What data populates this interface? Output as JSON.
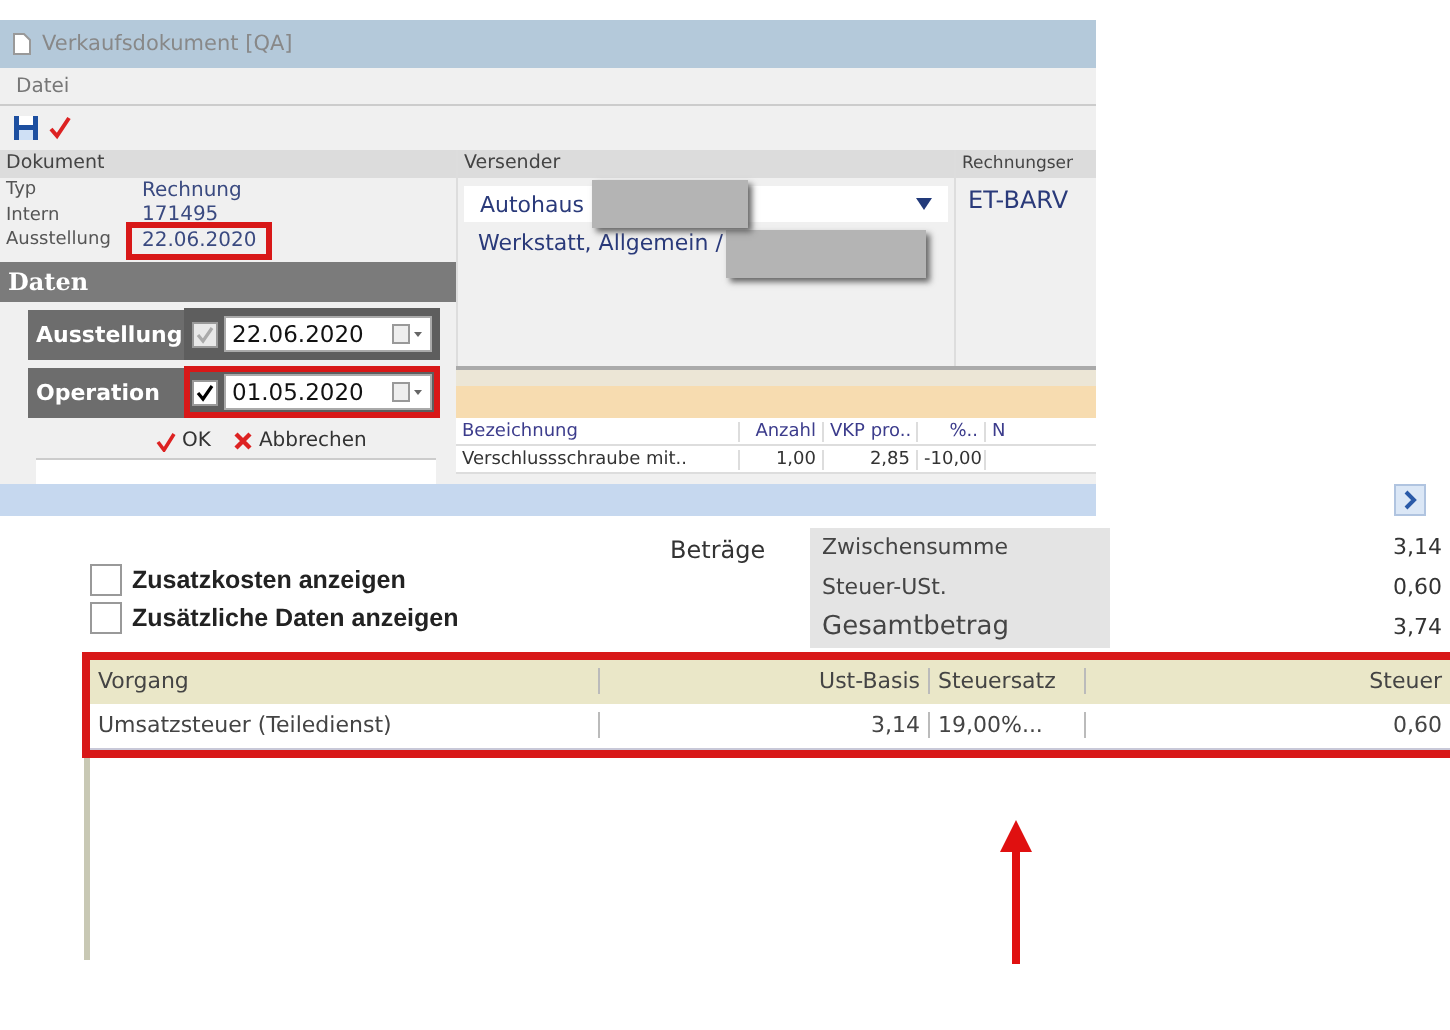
{
  "window": {
    "title": "Verkaufsdokument [QA]"
  },
  "menu": [
    "Datei"
  ],
  "dokument": {
    "header": "Dokument",
    "rows": [
      {
        "label": "Typ",
        "value": "Rechnung",
        "highlighted": false
      },
      {
        "label": "Intern",
        "value": "171495",
        "highlighted": false
      },
      {
        "label": "Ausstellung",
        "value": "22.06.2020",
        "highlighted": true
      }
    ]
  },
  "versender": {
    "header": "Versender",
    "company": "Autohaus",
    "contact": "Werkstatt,  Allgemein /"
  },
  "rechnungsempfaenger": {
    "header": "Rechnungser",
    "value": "ET-BARV"
  },
  "daten_popup": {
    "title": "Daten",
    "rows": [
      {
        "label": "Ausstellung",
        "checked": true,
        "disabled": true,
        "date": "22.06.2020",
        "highlighted": false
      },
      {
        "label": "Operation",
        "checked": true,
        "disabled": false,
        "date": "01.05.2020",
        "highlighted": true
      }
    ],
    "buttons": [
      {
        "kind": "ok",
        "label": "OK"
      },
      {
        "kind": "cancel",
        "label": "Abbrechen"
      }
    ]
  },
  "items_table": {
    "columns": [
      "Bezeichnung",
      "Anzahl",
      "VKP pro..",
      "%..",
      "N"
    ],
    "rows": [
      [
        "Verschlussschraube mit..",
        "1,00",
        "2,85",
        "-10,00",
        ""
      ]
    ]
  },
  "options": [
    {
      "label": "Zusatzkosten anzeigen",
      "checked": false
    },
    {
      "label": "Zusätzliche Daten anzeigen",
      "checked": false
    }
  ],
  "betraege": {
    "label": "Beträge",
    "rows": [
      {
        "label": "Zwischensumme",
        "value": "3,14"
      },
      {
        "label": "Steuer-USt.",
        "value": "0,60"
      },
      {
        "label": "Gesamtbetrag",
        "value": "3,74"
      }
    ]
  },
  "tax_table": {
    "highlighted": true,
    "columns": [
      "Vorgang",
      "Ust-Basis",
      "Steuersatz",
      "Steuer"
    ],
    "rows": [
      [
        "Umsatzsteuer (Teiledienst)",
        "3,14",
        "19,00%...",
        "0,60"
      ]
    ]
  }
}
